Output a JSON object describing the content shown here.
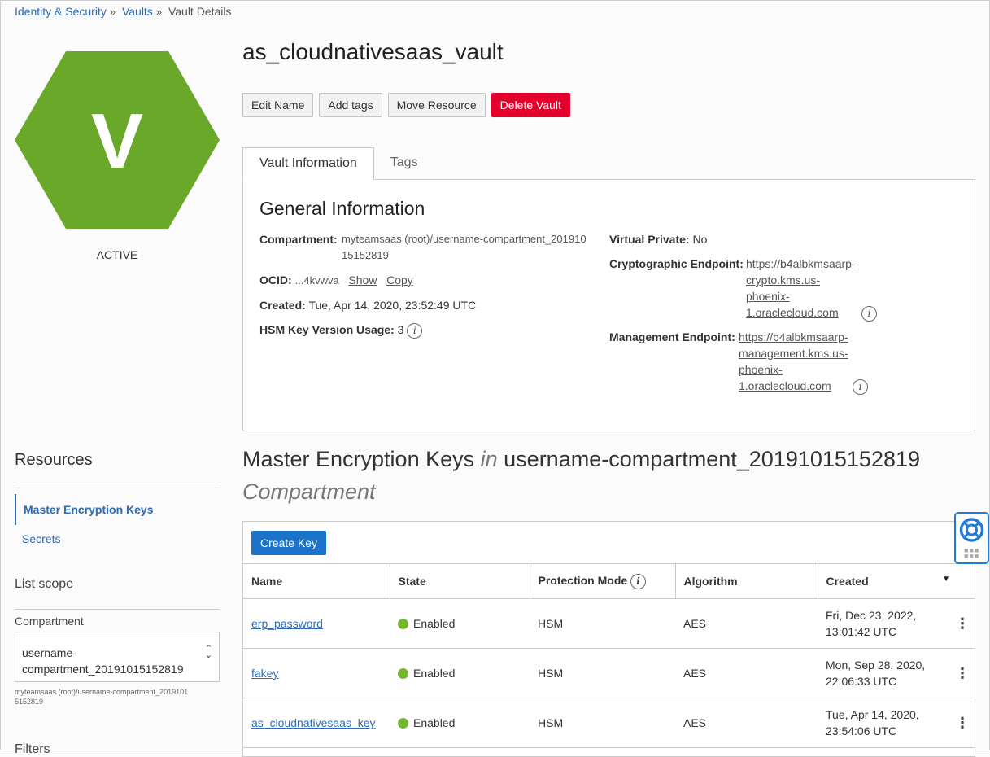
{
  "breadcrumb": {
    "items": [
      "Identity & Security",
      "Vaults",
      "Vault Details"
    ],
    "separator": "»"
  },
  "vault": {
    "badge_letter": "V",
    "badge_color": "#6aa82a",
    "status": "ACTIVE",
    "name": "as_cloudnativesaas_vault"
  },
  "actions": {
    "edit_name": "Edit Name",
    "add_tags": "Add tags",
    "move_resource": "Move Resource",
    "delete_vault": "Delete Vault"
  },
  "tabs": {
    "vault_information": "Vault Information",
    "tags": "Tags"
  },
  "general_info": {
    "heading": "General Information",
    "compartment_label": "Compartment:",
    "compartment_line1": "myteamsaas (root)/username-compartment_201910",
    "compartment_line2": "15152819",
    "ocid_label": "OCID:",
    "ocid_value": "...4kvwva",
    "ocid_show": "Show",
    "ocid_copy": "Copy",
    "created_label": "Created:",
    "created_value": "Tue, Apr 14, 2020, 23:52:49 UTC",
    "hsm_label": "HSM Key Version Usage:",
    "hsm_value": "3",
    "virtual_private_label": "Virtual Private:",
    "virtual_private_value": "No",
    "crypto_label": "Cryptographic Endpoint:",
    "crypto_lines": [
      "https://b4albkmsaarp-",
      "crypto.kms.us-",
      "phoenix-",
      "1.oraclecloud.com"
    ],
    "mgmt_label": "Management Endpoint:",
    "mgmt_lines": [
      "https://b4albkmsaarp-",
      "management.kms.us-",
      "phoenix-",
      "1.oraclecloud.com"
    ],
    "info_glyph": "i"
  },
  "resources": {
    "title": "Resources",
    "items": [
      "Master Encryption Keys",
      "Secrets"
    ]
  },
  "list_scope": {
    "title": "List scope",
    "compartment_label": "Compartment",
    "compartment_line1": "username-",
    "compartment_line2": "compartment_20191015152819",
    "hint_line1": "myteamsaas (root)/username-compartment_2019101",
    "hint_line2": "5152819",
    "filters_title": "Filters"
  },
  "keys": {
    "title_main": "Master Encryption Keys",
    "title_in": "in",
    "title_compartment": "username-compartment_20191015152819",
    "title_suffix": "Compartment",
    "create_button": "Create Key",
    "columns": [
      "Name",
      "State",
      "Protection Mode",
      "Algorithm",
      "Created"
    ],
    "rows": [
      {
        "name": "erp_password",
        "state": "Enabled",
        "protection": "HSM",
        "algorithm": "AES",
        "created_line1": "Fri, Dec 23, 2022,",
        "created_line2": "13:01:42 UTC"
      },
      {
        "name": "fakey",
        "state": "Enabled",
        "protection": "HSM",
        "algorithm": "AES",
        "created_line1": "Mon, Sep 28, 2020,",
        "created_line2": "22:06:33 UTC"
      },
      {
        "name": "as_cloudnativesaas_key",
        "state": "Enabled",
        "protection": "HSM",
        "algorithm": "AES",
        "created_line1": "Tue, Apr 14, 2020,",
        "created_line2": "23:54:06 UTC"
      }
    ],
    "state_color": "#74b72e"
  },
  "colors": {
    "link": "#2c6bb5",
    "danger": "#e4002b",
    "primary": "#1a73c8"
  }
}
